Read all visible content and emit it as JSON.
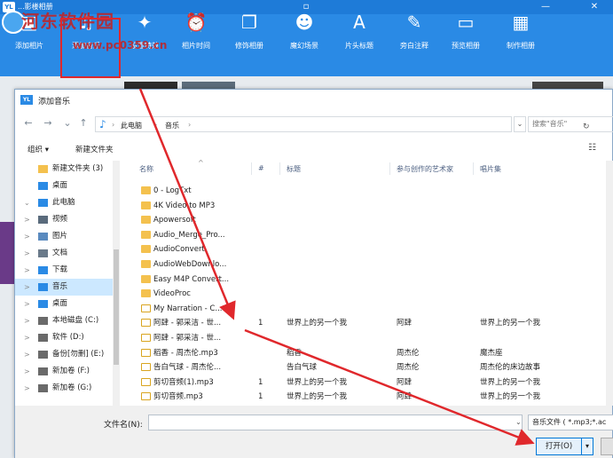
{
  "app": {
    "title": "...影楼相册",
    "logo": "YL",
    "controls": [
      "▫",
      "—",
      "✕"
    ],
    "toolbar": [
      {
        "label": "添加相片",
        "icon": "add-photo-icon"
      },
      {
        "label": "添加音乐",
        "icon": "music-note-icon"
      },
      {
        "label": "设置特效",
        "icon": "effects-icon"
      },
      {
        "label": "相片时间",
        "icon": "alarm-clock-icon"
      },
      {
        "label": "修饰相册",
        "icon": "layers-icon"
      },
      {
        "label": "魔幻场景",
        "icon": "masks-icon"
      },
      {
        "label": "片头标题",
        "icon": "a-letter-icon"
      },
      {
        "label": "旁白注释",
        "icon": "edit-icon"
      },
      {
        "label": "预览相册",
        "icon": "monitor-icon"
      },
      {
        "label": "制作相册",
        "icon": "grid-icon"
      }
    ],
    "watermark": "河东软件园",
    "watermark_url": "www.pc0359.cn"
  },
  "dialog": {
    "logo": "YL",
    "title": "添加音乐",
    "nav": {
      "back": "←",
      "forward": "→",
      "dropdown": "⌄",
      "up": "↑"
    },
    "address": [
      "此电脑",
      "音乐"
    ],
    "search_placeholder": "搜索\"音乐\"",
    "commands": {
      "organize": "组织 ▾",
      "new_folder": "新建文件夹"
    },
    "tree": [
      {
        "label": "新建文件夹 (3)",
        "icon": "folder",
        "exp": "",
        "selected": false
      },
      {
        "label": "桌面",
        "icon": "desktop",
        "exp": "",
        "selected": false
      },
      {
        "label": "此电脑",
        "icon": "pc",
        "exp": "⌄",
        "selected": false
      },
      {
        "label": "视频",
        "icon": "video",
        "exp": ">",
        "selected": false
      },
      {
        "label": "图片",
        "icon": "picture",
        "exp": ">",
        "selected": false
      },
      {
        "label": "文档",
        "icon": "doc",
        "exp": ">",
        "selected": false
      },
      {
        "label": "下载",
        "icon": "download",
        "exp": ">",
        "selected": false
      },
      {
        "label": "音乐",
        "icon": "music",
        "exp": ">",
        "selected": true
      },
      {
        "label": "桌面",
        "icon": "desktop",
        "exp": ">",
        "selected": false
      },
      {
        "label": "本地磁盘 (C:)",
        "icon": "drive",
        "exp": ">",
        "selected": false
      },
      {
        "label": "软件 (D:)",
        "icon": "drive",
        "exp": ">",
        "selected": false
      },
      {
        "label": "备份[勿删] (E:)",
        "icon": "drive",
        "exp": ">",
        "selected": false
      },
      {
        "label": "新加卷 (F:)",
        "icon": "drive",
        "exp": ">",
        "selected": false
      },
      {
        "label": "新加卷 (G:)",
        "icon": "drive",
        "exp": ">",
        "selected": false
      }
    ],
    "columns": {
      "name": "名称",
      "num": "#",
      "title": "标题",
      "artist": "参与创作的艺术家",
      "album": "唱片集"
    },
    "files": [
      {
        "name": "0 - LogTxt",
        "type": "folder",
        "num": "",
        "title": "",
        "artist": "",
        "album": ""
      },
      {
        "name": "4K Video to MP3",
        "type": "folder",
        "num": "",
        "title": "",
        "artist": "",
        "album": ""
      },
      {
        "name": "Apowersoft",
        "type": "folder",
        "num": "",
        "title": "",
        "artist": "",
        "album": ""
      },
      {
        "name": "Audio_Merge_Pro...",
        "type": "folder",
        "num": "",
        "title": "",
        "artist": "",
        "album": ""
      },
      {
        "name": "AudioConvert",
        "type": "folder",
        "num": "",
        "title": "",
        "artist": "",
        "album": ""
      },
      {
        "name": "AudioWebDownlo...",
        "type": "folder",
        "num": "",
        "title": "",
        "artist": "",
        "album": ""
      },
      {
        "name": "Easy M4P Convert...",
        "type": "folder",
        "num": "",
        "title": "",
        "artist": "",
        "album": ""
      },
      {
        "name": "VideoProc",
        "type": "folder",
        "num": "",
        "title": "",
        "artist": "",
        "album": ""
      },
      {
        "name": "My Narration - C...",
        "type": "music",
        "num": "",
        "title": "",
        "artist": "",
        "album": ""
      },
      {
        "name": "阿肆 - 郭采洁 - 世...",
        "type": "music",
        "num": "1",
        "title": "世界上的另一个我",
        "artist": "阿肆",
        "album": "世界上的另一个我"
      },
      {
        "name": "阿肆 - 郭采洁 - 世...",
        "type": "music",
        "num": "",
        "title": "",
        "artist": "",
        "album": ""
      },
      {
        "name": "稻香 - 周杰伦.mp3",
        "type": "music",
        "num": "",
        "title": "稻香",
        "artist": "周杰伦",
        "album": "魔杰座"
      },
      {
        "name": "告白气球 - 周杰伦...",
        "type": "music",
        "num": "",
        "title": "告白气球",
        "artist": "周杰伦",
        "album": "周杰伦的床边故事"
      },
      {
        "name": "剪切音频(1).mp3",
        "type": "music",
        "num": "1",
        "title": "世界上的另一个我",
        "artist": "阿肆",
        "album": "世界上的另一个我"
      },
      {
        "name": "剪切音频.mp3",
        "type": "music",
        "num": "1",
        "title": "世界上的另一个我",
        "artist": "阿肆",
        "album": "世界上的另一个我"
      }
    ],
    "filename_label": "文件名(N):",
    "filename_value": "",
    "filetype": "音乐文件 ( *.mp3;*.ac",
    "open_label": "打开(O)",
    "open_dropdown": "▾",
    "cancel_label": ""
  },
  "colors": {
    "toolbar": "#2a8ae5",
    "highlight": "#e0282c",
    "arrow": "#e0282c"
  }
}
